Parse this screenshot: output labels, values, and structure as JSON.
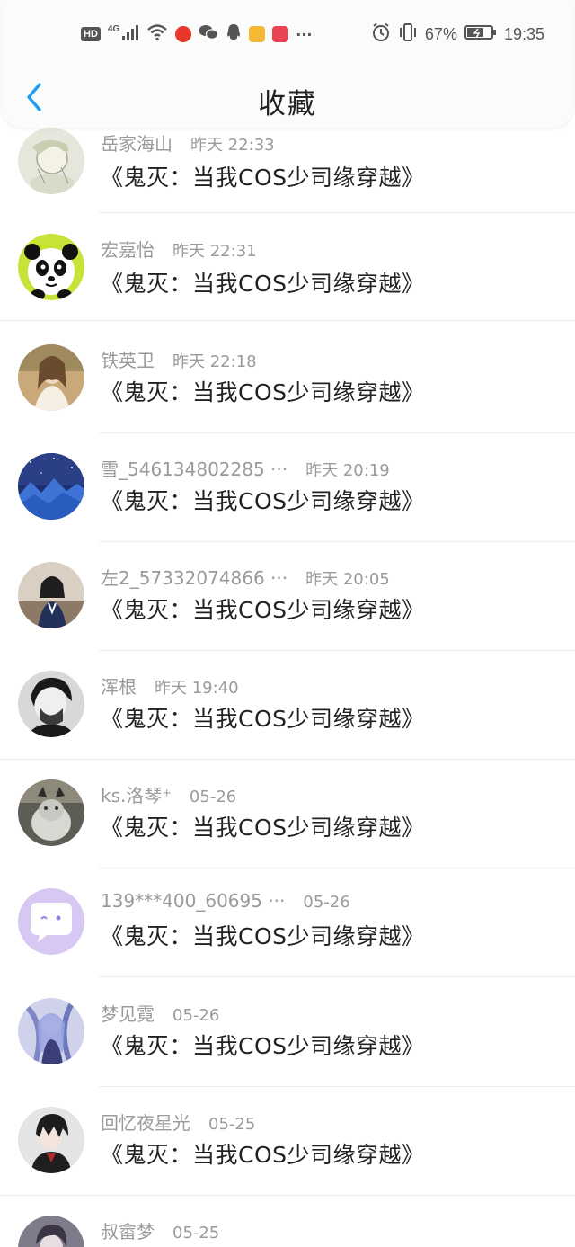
{
  "status_bar": {
    "hd": "HD",
    "network": "4G",
    "battery_percent": "67%",
    "time": "19:35",
    "more": "···"
  },
  "nav": {
    "title": "收藏"
  },
  "items": [
    {
      "name": "岳家海山",
      "time": "昨天 22:33",
      "title": "《鬼灭：当我COS少司缘穿越》"
    },
    {
      "name": "宏嘉怡",
      "time": "昨天 22:31",
      "title": "《鬼灭：当我COS少司缘穿越》"
    },
    {
      "name": "铁英卫",
      "time": "昨天 22:18",
      "title": "《鬼灭：当我COS少司缘穿越》"
    },
    {
      "name": "雪_546134802285 ···",
      "time": "昨天 20:19",
      "title": "《鬼灭：当我COS少司缘穿越》"
    },
    {
      "name": "左2_57332074866 ···",
      "time": "昨天 20:05",
      "title": "《鬼灭：当我COS少司缘穿越》"
    },
    {
      "name": "浑根",
      "time": "昨天 19:40",
      "title": "《鬼灭：当我COS少司缘穿越》"
    },
    {
      "name": "ks.洛琴⁺",
      "time": "05-26",
      "title": "《鬼灭：当我COS少司缘穿越》"
    },
    {
      "name": "139***400_60695 ···",
      "time": "05-26",
      "title": "《鬼灭：当我COS少司缘穿越》"
    },
    {
      "name": "梦见霓",
      "time": "05-26",
      "title": "《鬼灭：当我COS少司缘穿越》"
    },
    {
      "name": "回忆夜星光",
      "time": "05-25",
      "title": "《鬼灭：当我COS少司缘穿越》"
    },
    {
      "name": "叔畲梦",
      "time": "05-25",
      "title": ""
    }
  ],
  "colors": {
    "accent": "#1e9df2",
    "meta_text": "#9a9a9a",
    "title_text": "#222222",
    "divider": "#eeeeee"
  }
}
